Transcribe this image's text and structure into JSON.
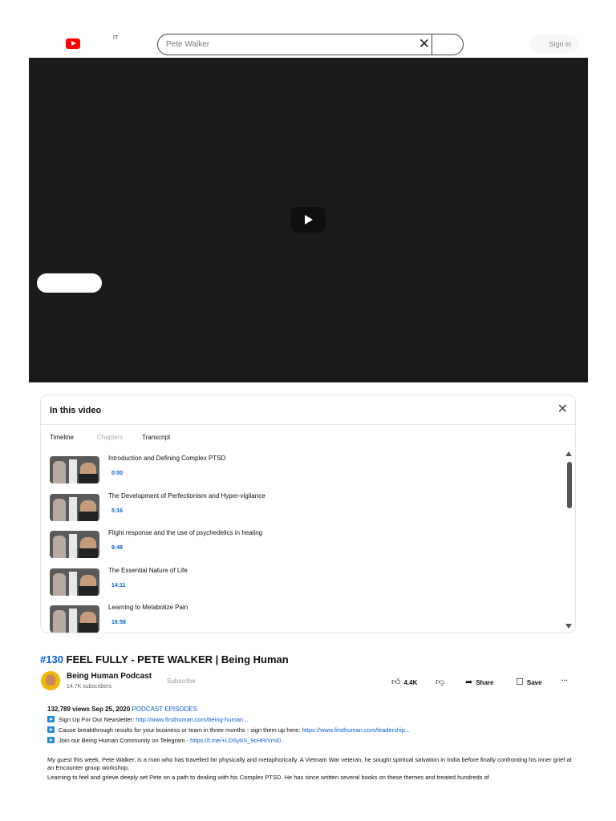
{
  "header": {
    "locale": "IT",
    "search_value": "Pete Walker",
    "clear_symbol": "✕",
    "signin_label": "Sign in"
  },
  "panel": {
    "title": "In this video",
    "close_symbol": "✕",
    "tabs": [
      "Timeline",
      "Chapters",
      "Transcript"
    ],
    "active_tabs": [
      "Timeline",
      "Transcript"
    ],
    "chapters": [
      {
        "title": "Introduction and Defining Complex PTSD",
        "time": "0:00"
      },
      {
        "title": "The Development of Perfectionism and Hyper-vigilance",
        "time": "5:16"
      },
      {
        "title": "Flight response and the use of psychedelics in healing",
        "time": "9:48"
      },
      {
        "title": "The Essential Nature of Life",
        "time": "14:11"
      },
      {
        "title": "Learning to Metabolize Pain",
        "time": "18:58"
      }
    ]
  },
  "video": {
    "title_tag": "#130",
    "title": "FEEL FULLY - PETE WALKER | Being Human",
    "channel": "Being Human Podcast",
    "subscribers": "14.7K subscribers",
    "subscribe_label": "Subscribe",
    "likes": "4.4K",
    "share_label": "Share",
    "save_label": "Save",
    "more_symbol": "···"
  },
  "description": {
    "views": "132,789 views",
    "date": "Sep 25, 2020",
    "category": "PODCAST EPISODES",
    "lines": [
      {
        "text": "Sign Up For Our Newsletter: ",
        "link": "http://www.firsthuman.com/being-human..."
      },
      {
        "text": "Cause breakthrough results for your business or team in three months - sign them up here: ",
        "link": "https://www.firsthuman.com/leadership..."
      },
      {
        "text": "Join our Being Human Community on Telegram - ",
        "link": "https://t.me/+LDSy6S_9cHRiYmI0"
      }
    ],
    "para1": "My guest this week, Pete Walker, is a man who has travelled far physically and metaphorically. A Vietnam War veteran, he sought spiritual salvation in India before finally confronting his inner grief at an Encounter group workshop.",
    "para2": "Learning to feel and grieve deeply set Pete on a path to dealing with his Complex PTSD. He has since written several books on these themes and treated hundreds of"
  }
}
